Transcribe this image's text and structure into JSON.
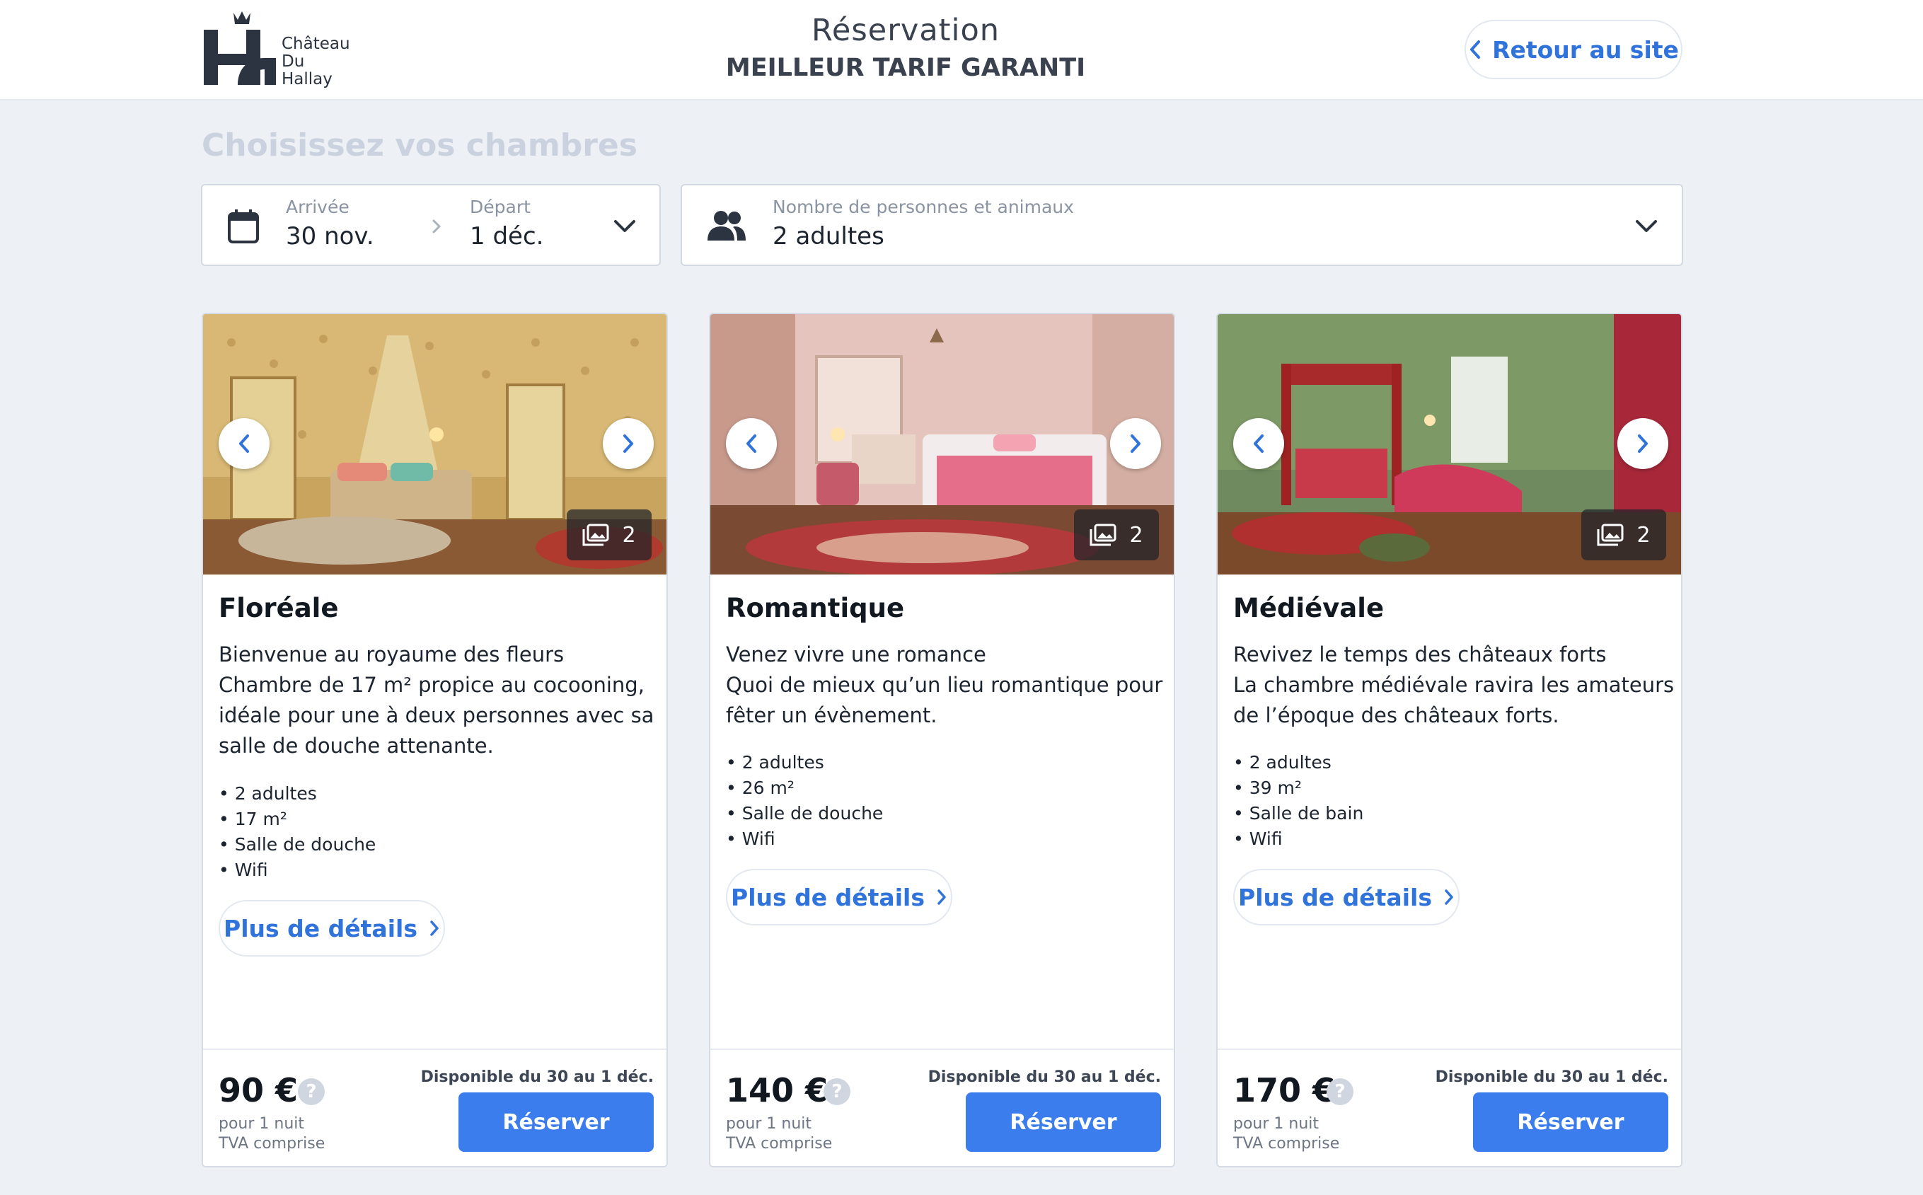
{
  "header": {
    "logo_lines": [
      "Château",
      "Du",
      "Hallay"
    ],
    "title": "Réservation",
    "subtitle": "MEILLEUR TARIF GARANTI",
    "back_label": "Retour au site"
  },
  "search": {
    "section_title": "Choisissez vos chambres",
    "arrival_label": "Arrivée",
    "arrival_value": "30 nov.",
    "departure_label": "Départ",
    "departure_value": "1 déc.",
    "guests_label": "Nombre de personnes et animaux",
    "guests_value": "2 adultes"
  },
  "rooms": [
    {
      "name": "Floréale",
      "description": [
        "Bienvenue au royaume des fleurs",
        "Chambre de 17 m² propice au cocooning,",
        "idéale pour une à deux personnes avec sa",
        "salle de douche attenante."
      ],
      "features": [
        "2 adultes",
        "17 m²",
        "Salle de douche",
        "Wifi"
      ],
      "photo_count": "2",
      "details_label": "Plus de détails",
      "price": "90 €",
      "price_unit": "pour 1 nuit",
      "tax_note": "TVA comprise",
      "availability": "Disponible du 30 au 1 déc.",
      "reserve_label": "Réserver",
      "help_glyph": "?"
    },
    {
      "name": "Romantique",
      "description": [
        "Venez vivre une romance",
        "Quoi de mieux qu’un lieu romantique pour",
        "fêter un évènement."
      ],
      "features": [
        "2 adultes",
        "26 m²",
        "Salle de douche",
        "Wifi"
      ],
      "photo_count": "2",
      "details_label": "Plus de détails",
      "price": "140 €",
      "price_unit": "pour 1 nuit",
      "tax_note": "TVA comprise",
      "availability": "Disponible du 30 au 1 déc.",
      "reserve_label": "Réserver",
      "help_glyph": "?"
    },
    {
      "name": "Médiévale",
      "description": [
        "Revivez le temps des châteaux forts",
        "La chambre médiévale ravira les amateurs",
        "de l’époque des châteaux forts."
      ],
      "features": [
        "2 adultes",
        "39 m²",
        "Salle de bain",
        "Wifi"
      ],
      "photo_count": "2",
      "details_label": "Plus de détails",
      "price": "170 €",
      "price_unit": "pour 1 nuit",
      "tax_note": "TVA comprise",
      "availability": "Disponible du 30 au 1 déc.",
      "reserve_label": "Réserver",
      "help_glyph": "?"
    }
  ],
  "colors": {
    "accent": "#3b7ded",
    "link": "#2f73db",
    "background": "#edf1f6"
  }
}
